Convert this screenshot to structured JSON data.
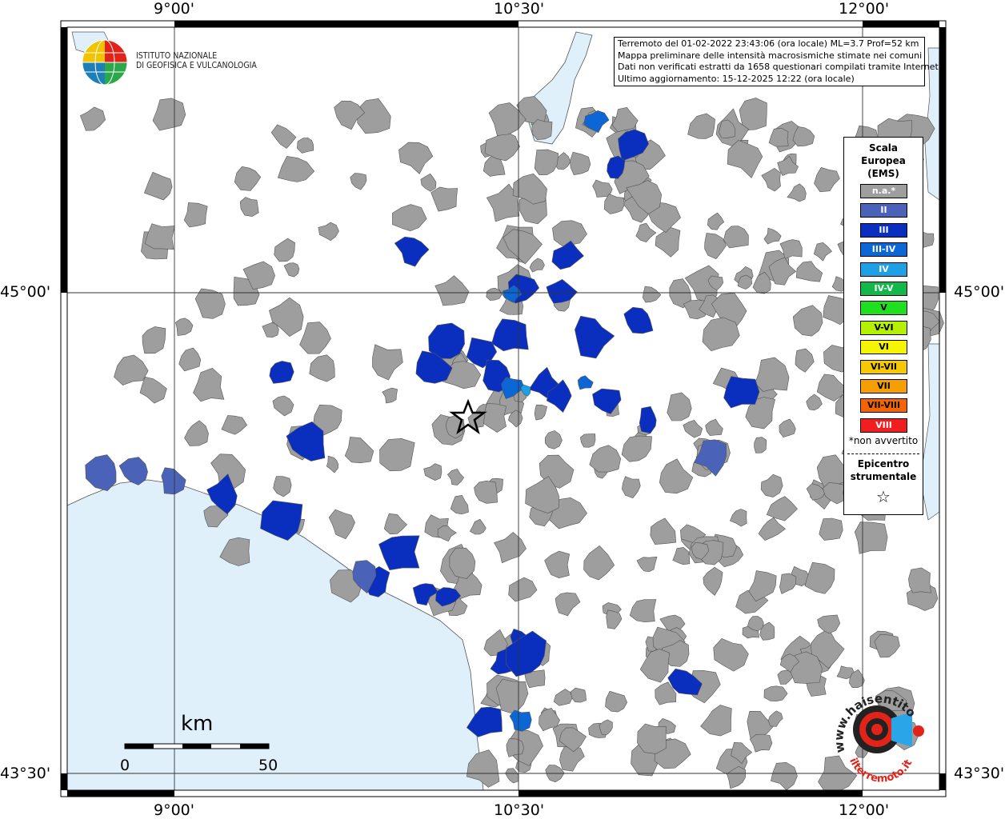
{
  "header": {
    "line1": "Terremoto del 01-02-2022 23:43:06 (ora locale) ML=3.7 Prof=52 km",
    "line2": "Mappa preliminare delle intensità macrosismiche stimate nei comuni",
    "line3": "Dati non verificati estratti da 1658 questionari compilati tramite Internet.",
    "line4": "Ultimo aggiornamento: 15-12-2025 12:22 (ora locale)"
  },
  "logo": {
    "line1": "ISTITUTO NAZIONALE",
    "line2": "DI GEOFISICA E VULCANOLOGIA",
    "icon": "ingv-globe-icon"
  },
  "axes": {
    "top": [
      "9°00'",
      "10°30'",
      "12°00'"
    ],
    "bottom": [
      "9°00'",
      "10°30'",
      "12°00'"
    ],
    "left": [
      "45°00'",
      "43°30'"
    ],
    "right": [
      "45°00'",
      "43°30'"
    ]
  },
  "legend": {
    "title1": "Scala",
    "title2": "Europea",
    "title3": "(EMS)",
    "items": [
      {
        "label": "n.a.*",
        "color": "#9e9e9e",
        "text_color": "#ffffff"
      },
      {
        "label": "II",
        "color": "#4a63b8",
        "text_color": "#ffffff"
      },
      {
        "label": "III",
        "color": "#0a2fbf",
        "text_color": "#ffffff"
      },
      {
        "label": "III-IV",
        "color": "#0d66d6",
        "text_color": "#ffffff"
      },
      {
        "label": "IV",
        "color": "#1ea0e6",
        "text_color": "#ffffff"
      },
      {
        "label": "IV-V",
        "color": "#12b84a",
        "text_color": "#ffffff"
      },
      {
        "label": "V",
        "color": "#1ee01e",
        "text_color": "#000000"
      },
      {
        "label": "V-VI",
        "color": "#b4f000",
        "text_color": "#000000"
      },
      {
        "label": "VI",
        "color": "#f5f500",
        "text_color": "#000000"
      },
      {
        "label": "VI-VII",
        "color": "#f5c800",
        "text_color": "#000000"
      },
      {
        "label": "VII",
        "color": "#f5a000",
        "text_color": "#000000"
      },
      {
        "label": "VII-VIII",
        "color": "#f56400",
        "text_color": "#000000"
      },
      {
        "label": "VIII",
        "color": "#f01e1e",
        "text_color": "#ffffff"
      }
    ],
    "note": "*non avvertito",
    "epi1": "Epicentro",
    "epi2": "strumentale",
    "epi_symbol": "☆"
  },
  "scale_bar": {
    "unit": "km",
    "start": "0",
    "end": "50"
  },
  "hsit": {
    "text1": "www.haisentito",
    "text2": "ilterremoto.it",
    "icon": "megaphone-ear-icon"
  },
  "colors": {
    "sea": "#dff0fb",
    "land_none": "#ffffff",
    "na": "#9e9e9e",
    "ii": "#4a63b8",
    "iii": "#0a2fbf",
    "iii_iv": "#0d66d6",
    "iv": "#1ea0e6"
  }
}
